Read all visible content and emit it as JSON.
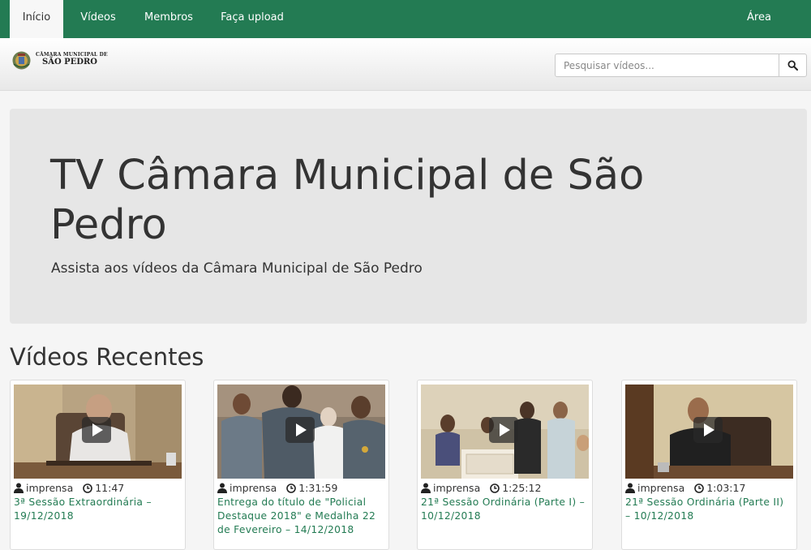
{
  "nav": {
    "tabs": [
      {
        "label": "Início",
        "active": true
      },
      {
        "label": "Vídeos",
        "active": false
      },
      {
        "label": "Membros",
        "active": false
      },
      {
        "label": "Faça upload",
        "active": false
      }
    ],
    "admin_label": "Área Administrativa"
  },
  "colors": {
    "brand_green": "#237b53",
    "link_green": "#237b53",
    "jumbotron_bg": "#e6e6e6",
    "page_bg": "#f5f5f5"
  },
  "header": {
    "logo_line1": "CÂMARA MUNICIPAL DE",
    "logo_line2": "SÃO PEDRO",
    "search_placeholder": "Pesquisar vídeos...",
    "search_icon": "search-icon"
  },
  "hero": {
    "title": "TV Câmara Municipal de São Pedro",
    "subtitle": "Assista aos vídeos da Câmara Municipal de São Pedro"
  },
  "recent": {
    "heading": "Vídeos Recentes",
    "videos": [
      {
        "author": "imprensa",
        "duration": "11:47",
        "title": "3ª Sessão Extraordinária – 19/12/2018"
      },
      {
        "author": "imprensa",
        "duration": "1:31:59",
        "title": "Entrega do título de \"Policial Destaque 2018\" e Medalha 22 de Fevereiro – 14/12/2018"
      },
      {
        "author": "imprensa",
        "duration": "1:25:12",
        "title": "21ª Sessão Ordinária (Parte I) – 10/12/2018"
      },
      {
        "author": "imprensa",
        "duration": "1:03:17",
        "title": "21ª Sessão Ordinária (Parte II) – 10/12/2018"
      }
    ]
  }
}
